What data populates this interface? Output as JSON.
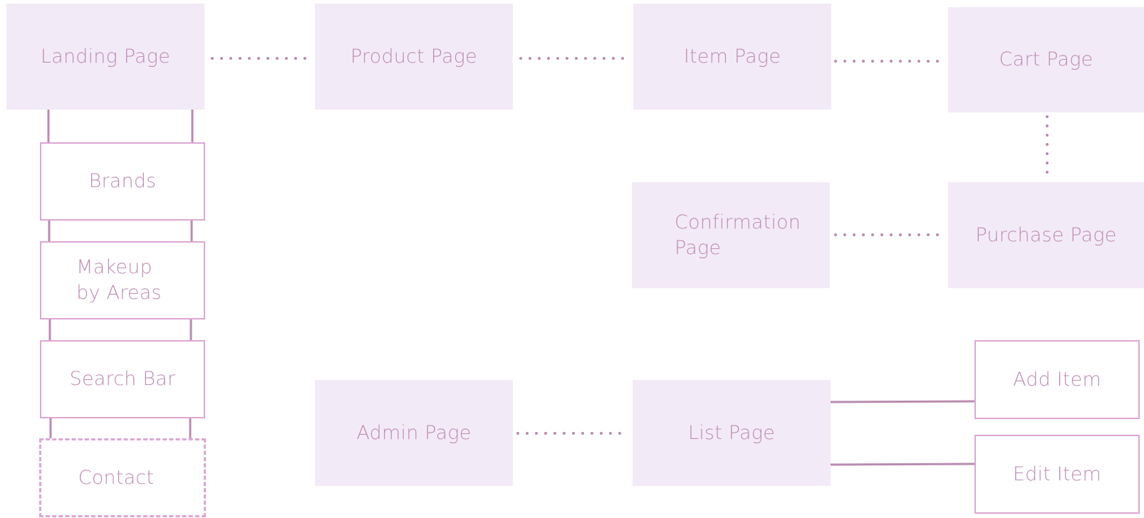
{
  "nodes": {
    "landing": "Landing Page",
    "product": "Product Page",
    "item": "Item Page",
    "cart": "Cart Page",
    "brands": "Brands",
    "makeup_line1": "Makeup",
    "makeup_line2": "by Areas",
    "search": "Search Bar",
    "contact": "Contact",
    "confirmation_line1": "Confirmation",
    "confirmation_line2": "Page",
    "purchase": "Purchase Page",
    "admin": "Admin Page",
    "list": "List Page",
    "add_item": "Add Item",
    "edit_item": "Edit Item"
  },
  "colors": {
    "text": "#bd8eb4",
    "filled_box": "#f3eaf7",
    "box_border": "#dca6d4",
    "connector": "#b98bb0"
  }
}
